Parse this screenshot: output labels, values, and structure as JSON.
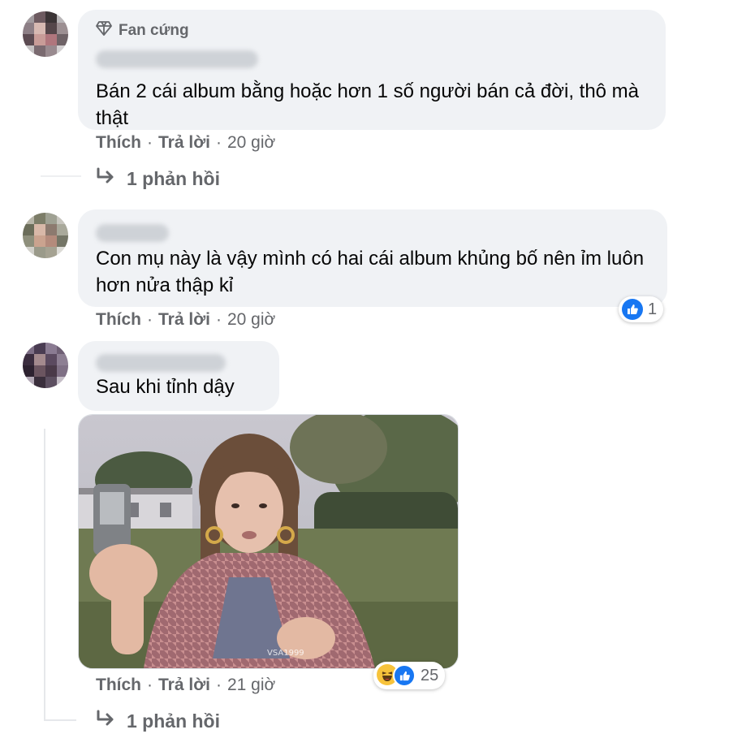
{
  "comments": [
    {
      "badge": "Fan cứng",
      "text": "Bán 2 cái album bằng hoặc hơn 1 số người bán cả đời, thô mà thật",
      "actions": {
        "like": "Thích",
        "reply": "Trả lời",
        "sep": "·",
        "time": "20 giờ"
      },
      "replies_label": "1 phản hồi"
    },
    {
      "text": "Con mụ này là vậy mình có hai cái album khủng bố nên ỉm luôn hơn nửa thập kỉ",
      "actions": {
        "like": "Thích",
        "reply": "Trả lời",
        "sep": "·",
        "time": "20 giờ"
      },
      "reaction_count": "1"
    },
    {
      "text": "Sau khi tỉnh dậy",
      "image_caption": "VSA1999",
      "actions": {
        "like": "Thích",
        "reply": "Trả lời",
        "sep": "·",
        "time": "21 giờ"
      },
      "reaction_count": "25",
      "replies_label": "1 phản hồi"
    }
  ],
  "colors": {
    "bubble": "#f0f2f5",
    "meta": "#65676b",
    "like_blue": "#1877f2",
    "haha_yellow": "#f7c33b"
  },
  "icons": [
    "diamond-icon",
    "reply-arrow-icon",
    "like-reaction-icon",
    "haha-reaction-icon"
  ]
}
